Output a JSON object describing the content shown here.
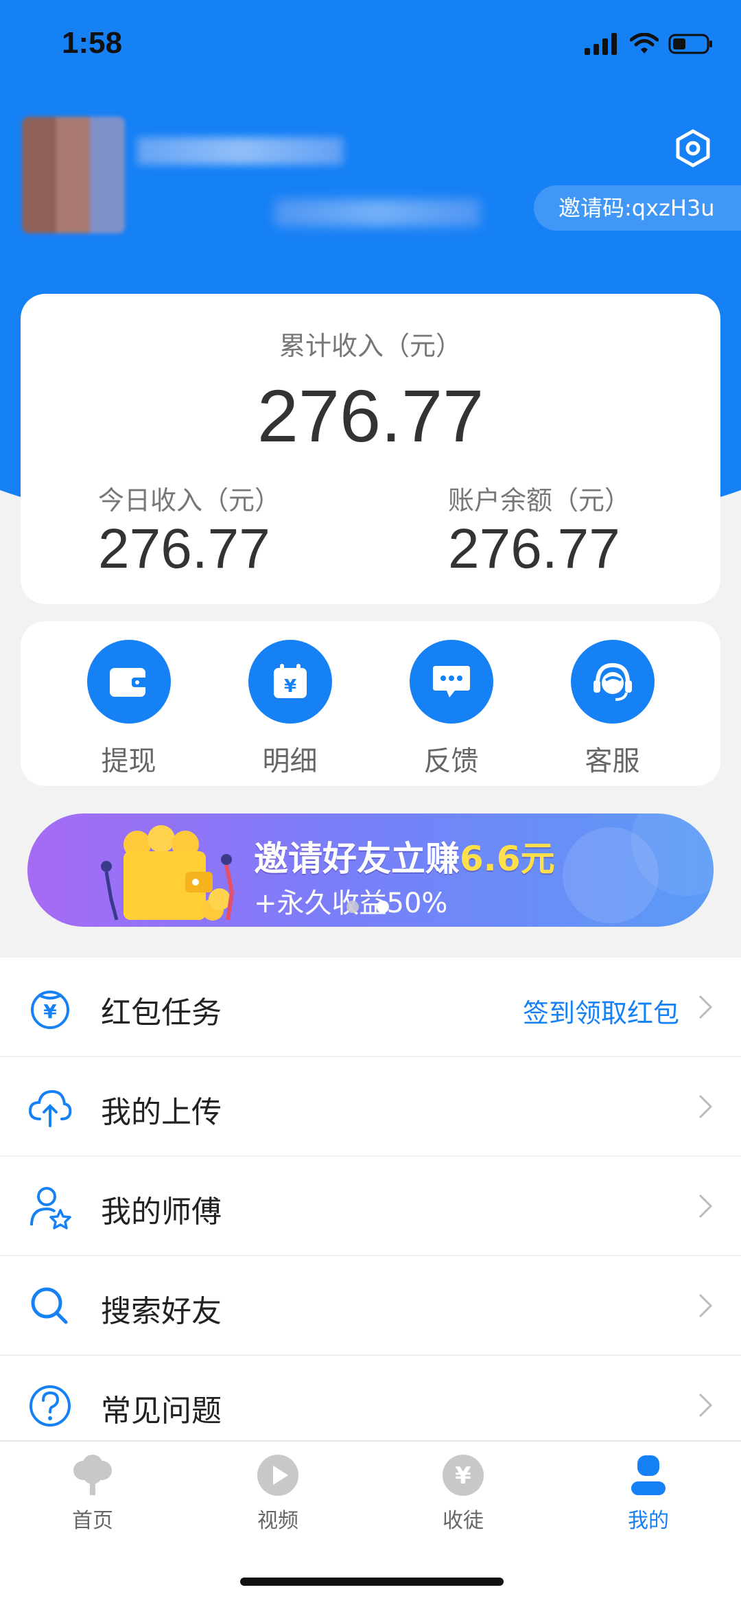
{
  "status_bar": {
    "time": "1:58"
  },
  "profile": {
    "invite_code": "邀请码:qxzH3u"
  },
  "earnings": {
    "total_label": "累计收入（元）",
    "total_value": "276.77",
    "today_label": "今日收入（元）",
    "today_value": "276.77",
    "balance_label": "账户余额（元）",
    "balance_value": "276.77"
  },
  "quick_actions": [
    {
      "label": "提现",
      "icon": "wallet-icon"
    },
    {
      "label": "明细",
      "icon": "calendar-yen-icon"
    },
    {
      "label": "反馈",
      "icon": "chat-bubble-icon"
    },
    {
      "label": "客服",
      "icon": "headset-icon"
    }
  ],
  "banner": {
    "line1_prefix": "邀请好友立赚",
    "line1_highlight": "6.6元",
    "line2": "+永久收益50%",
    "active_dot": 2,
    "dot_count": 2
  },
  "menu": [
    {
      "label": "红包任务",
      "hint": "签到领取红包",
      "icon": "red-envelope-yen-icon"
    },
    {
      "label": "我的上传",
      "hint": "",
      "icon": "cloud-upload-icon"
    },
    {
      "label": "我的师傅",
      "hint": "",
      "icon": "user-star-icon"
    },
    {
      "label": "搜索好友",
      "hint": "",
      "icon": "search-icon"
    },
    {
      "label": "常见问题",
      "hint": "",
      "icon": "question-icon"
    }
  ],
  "tabbar": [
    {
      "label": "首页",
      "icon": "tree-icon",
      "active": false
    },
    {
      "label": "视频",
      "icon": "play-icon",
      "active": false
    },
    {
      "label": "收徒",
      "icon": "yen-coin-icon",
      "active": false
    },
    {
      "label": "我的",
      "icon": "person-icon",
      "active": true
    }
  ],
  "colors": {
    "primary": "#1680f5",
    "highlight": "#ffe04a"
  }
}
